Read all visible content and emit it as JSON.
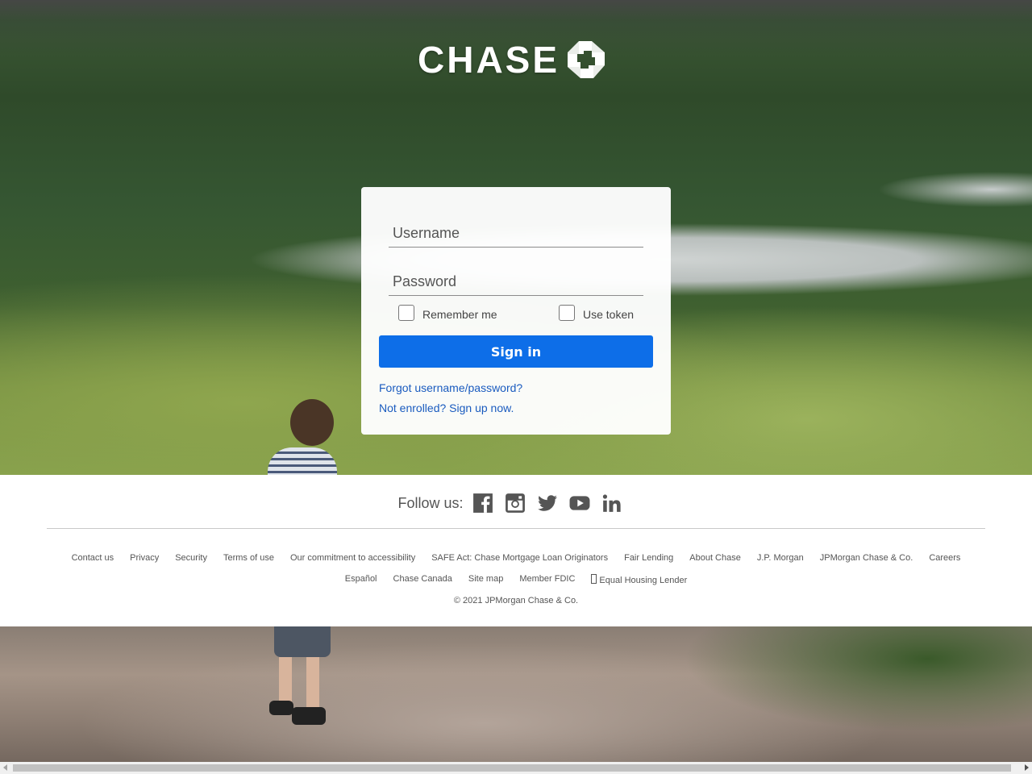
{
  "logo": {
    "text": "CHASE",
    "icon": "octagon-logo-icon"
  },
  "login": {
    "username_placeholder": "Username",
    "password_placeholder": "Password",
    "remember_label": "Remember me",
    "token_label": "Use token",
    "signin_label": "Sign in",
    "forgot_link": "Forgot username/password?",
    "enroll_link": "Not enrolled? Sign up now."
  },
  "footer": {
    "follow_label": "Follow us:",
    "social_icons": [
      "facebook-icon",
      "instagram-icon",
      "twitter-icon",
      "youtube-icon",
      "linkedin-icon"
    ],
    "links_row1": [
      "Contact us",
      "Privacy",
      "Security",
      "Terms of use",
      "Our commitment to accessibility",
      "SAFE Act: Chase Mortgage Loan Originators",
      "Fair Lending",
      "About Chase",
      "J.P. Morgan",
      "JPMorgan Chase & Co.",
      "Careers"
    ],
    "links_row2": [
      "Español",
      "Chase Canada",
      "Site map",
      "Member FDIC",
      "Equal Housing Lender"
    ],
    "copyright": "© 2021 JPMorgan Chase & Co."
  },
  "colors": {
    "signin_button": "#0d6ee8",
    "link": "#1a5bbf",
    "footer_bg": "#ffffff"
  }
}
